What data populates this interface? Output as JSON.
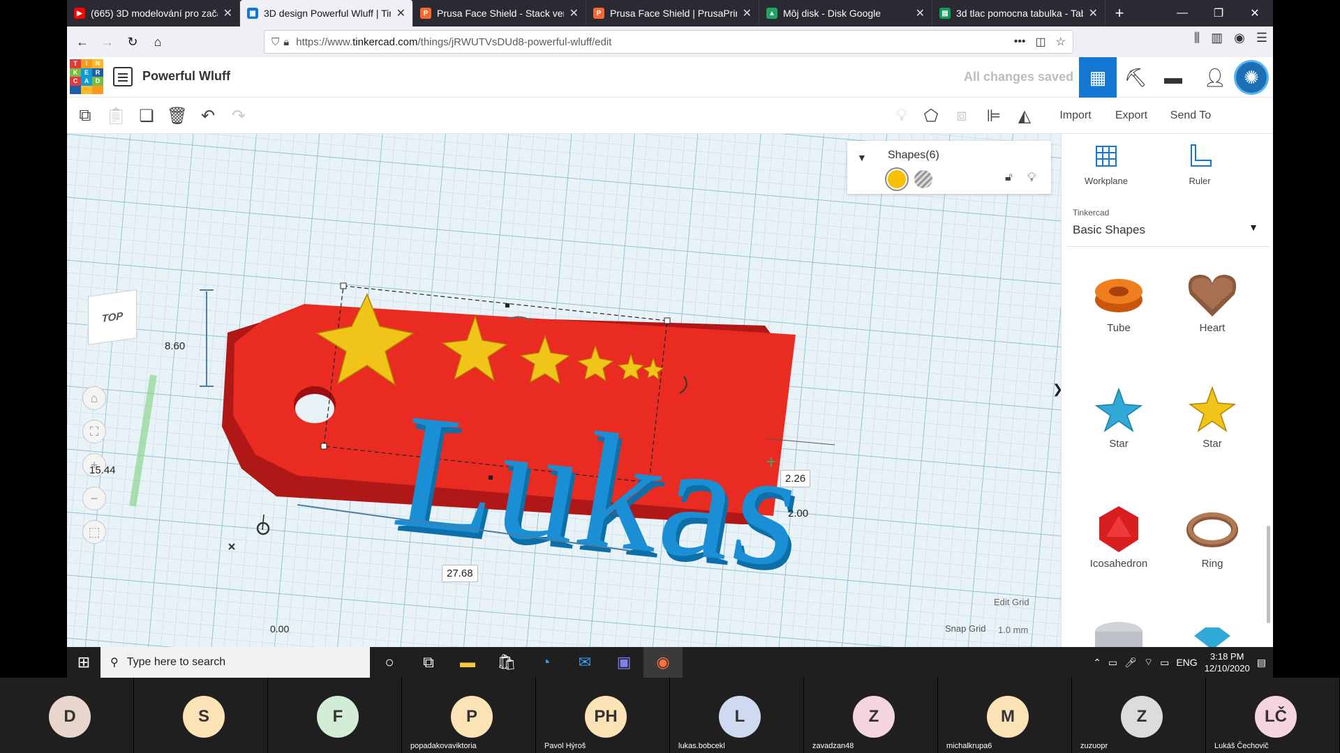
{
  "browser": {
    "tabs": [
      {
        "title": "(665) 3D modelování pro začá",
        "fav": "youtube-icon",
        "color": "#ff0000",
        "active": false
      },
      {
        "title": "3D design Powerful Wluff | Tin",
        "fav": "tinkercad-icon",
        "color": "#1477d1",
        "active": true
      },
      {
        "title": "Prusa Face Shield - Stack ver.",
        "fav": "printables-icon",
        "color": "#fa6831",
        "active": false
      },
      {
        "title": "Prusa Face Shield | PrusaPrinte",
        "fav": "printables-icon",
        "color": "#fa6831",
        "active": false
      },
      {
        "title": "Môj disk - Disk Google",
        "fav": "google-drive-icon",
        "color": "#1fa463",
        "active": false
      },
      {
        "title": "3d tlac pomocna tabulka - Tab",
        "fav": "google-sheets-icon",
        "color": "#0f9d58",
        "active": false
      }
    ],
    "url_prefix": "https://www.",
    "url_host": "tinkercad.com",
    "url_path": "/things/jRWUTVsDUd8-powerful-wluff/edit"
  },
  "header": {
    "logo_letters": [
      "T",
      "I",
      "N",
      "K",
      "E",
      "R",
      "C",
      "A",
      "D"
    ],
    "logo_colors": [
      "#e03a3e",
      "#f89a1c",
      "#fcb827",
      "#78bc43",
      "#0f9bd7",
      "#1d5ea9",
      "#e03a3e",
      "#0f9bd7",
      "#78bc43",
      "#1d5ea9",
      "#fcb827",
      "#f89a1c"
    ],
    "design_name": "Powerful Wluff",
    "save_status": "All changes saved"
  },
  "toolbar": {
    "import": "Import",
    "export": "Export",
    "send_to": "Send To"
  },
  "inspector": {
    "title": "Shapes(6)",
    "solid_color": "#f8c000"
  },
  "viewport": {
    "viewcube": "TOP",
    "dims": {
      "height_label": "8.60",
      "width_label": "15.44",
      "length_label": "27.68",
      "elev_label": "2.26",
      "thick_label": "2.00",
      "origin_label": "0.00"
    },
    "text3d": "Lukas",
    "edit_grid": "Edit Grid",
    "snap_label": "Snap Grid",
    "snap_value": "1.0 mm"
  },
  "panel": {
    "workplane": "Workplane",
    "ruler": "Ruler",
    "lib_category": "Tinkercad",
    "lib_name": "Basic Shapes",
    "shapes": [
      "Tube",
      "Heart",
      "Star",
      "Star",
      "Icosahedron",
      "Ring"
    ]
  },
  "taskbar": {
    "search_placeholder": "Type here to search",
    "lang": "ENG",
    "time": "3:18 PM",
    "date": "12/10/2020"
  },
  "participants": [
    {
      "initials": "D",
      "name": "",
      "color": "#e8d5cc"
    },
    {
      "initials": "S",
      "name": "",
      "color": "#fbe3b5"
    },
    {
      "initials": "F",
      "name": "",
      "color": "#d3ecd6"
    },
    {
      "initials": "P",
      "name": "popadakovaviktoria",
      "color": "#fbe3b5"
    },
    {
      "initials": "PH",
      "name": "Pavol Hýroš",
      "color": "#fbe3b5"
    },
    {
      "initials": "L",
      "name": "lukas.bobcekl",
      "color": "#cfd9f0"
    },
    {
      "initials": "Z",
      "name": "zavadzan48",
      "color": "#f3d4df"
    },
    {
      "initials": "M",
      "name": "michalkrupa6",
      "color": "#fbe3b5"
    },
    {
      "initials": "Z",
      "name": "zuzuopr",
      "color": "#dcdcdc"
    },
    {
      "initials": "LČ",
      "name": "Lukáš Čechovič",
      "color": "#f3d4df"
    }
  ]
}
